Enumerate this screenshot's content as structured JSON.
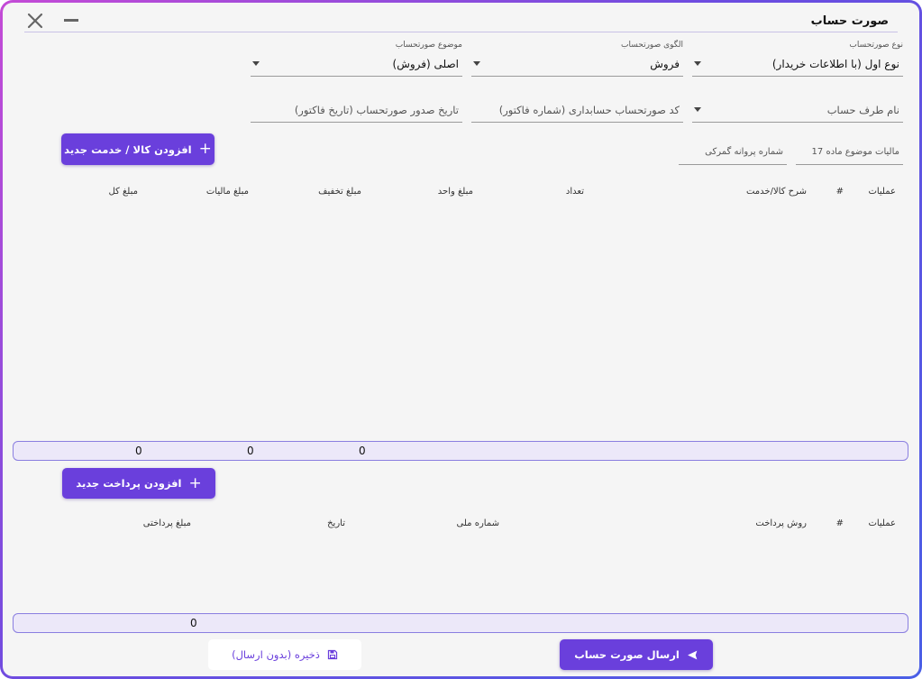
{
  "window": {
    "title": "صورت حساب"
  },
  "header_fields": {
    "invoice_type": {
      "label": "نوع صورتحساب",
      "value": "نوع اول (با اطلاعات خریدار)"
    },
    "invoice_pattern": {
      "label": "الگوی صورتحساب",
      "value": "فروش"
    },
    "invoice_subject": {
      "label": "موضوع صورتحساب",
      "value": "اصلی (فروش)"
    }
  },
  "second_row": {
    "party_name": {
      "placeholder": "نام طرف حساب"
    },
    "accounting_code": {
      "placeholder": "کد صورتحساب حسابداری (شماره فاکتور)"
    },
    "issue_date": {
      "placeholder": "تاریخ صدور صورتحساب (تاریخ فاکتور)"
    }
  },
  "third_row": {
    "tax_article17": {
      "placeholder": "مالیات موضوع ماده 17"
    },
    "customs_license": {
      "placeholder": "شماره پروانه گمرکی"
    }
  },
  "buttons": {
    "add_item": "افزودن کالا / خدمت جدید",
    "add_payment": "افزودن پرداخت جدید",
    "send_invoice": "ارسال صورت حساب",
    "save_draft": "ذخیره (بدون ارسال)"
  },
  "items_table": {
    "headers": {
      "operations": "عملیات",
      "index": "#",
      "description": "شرح کالا/خدمت",
      "quantity": "تعداد",
      "unit_price": "مبلغ واحد",
      "discount": "مبلغ تخفیف",
      "tax": "مبلغ مالیات",
      "total": "مبلغ کل"
    },
    "totals": {
      "discount": "0",
      "tax": "0",
      "total": "0"
    }
  },
  "payments_table": {
    "headers": {
      "operations": "عملیات",
      "index": "#",
      "method": "روش پرداخت",
      "national_id": "شماره ملی",
      "date": "تاریخ",
      "amount": "مبلغ پرداختی"
    },
    "totals": {
      "amount": "0"
    }
  },
  "icons": {
    "close": "close-icon",
    "minimize": "minimize-icon",
    "plus": "plus-icon",
    "send": "send-icon",
    "save": "save-icon"
  },
  "colors": {
    "accent": "#6a3fdc",
    "frame_gradient_start": "#c44bd6",
    "frame_gradient_end": "#4a5fe6",
    "summary_bar": "#ece8f9"
  }
}
